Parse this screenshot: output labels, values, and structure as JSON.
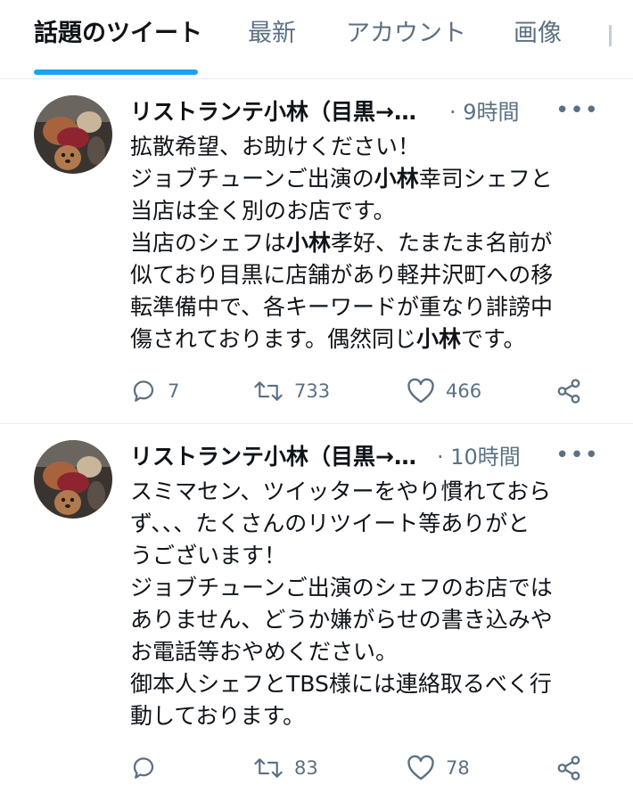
{
  "tabs": [
    {
      "label": "話題のツイート",
      "active": true
    },
    {
      "label": "最新",
      "active": false
    },
    {
      "label": "アカウント",
      "active": false
    },
    {
      "label": "画像",
      "active": false
    }
  ],
  "tweets": [
    {
      "display_name": "リストランテ小林（目黒→…",
      "time": "· 9時間",
      "more_label": "•••",
      "lines": [
        [
          {
            "t": "拡散希望、お助けください！",
            "b": false
          }
        ],
        [
          {
            "t": "ジョブチューンご出演の",
            "b": false
          },
          {
            "t": "小林",
            "b": true
          },
          {
            "t": "幸司シェフと",
            "b": false
          }
        ],
        [
          {
            "t": "当店は全く別のお店です。",
            "b": false
          }
        ],
        [
          {
            "t": "当店のシェフは",
            "b": false
          },
          {
            "t": "小林",
            "b": true
          },
          {
            "t": "孝好、たまたま名前が",
            "b": false
          }
        ],
        [
          {
            "t": "似ており目黒に店舗があり軽井沢町への移",
            "b": false
          }
        ],
        [
          {
            "t": "転準備中で、各キーワードが重なり誹謗中",
            "b": false
          }
        ],
        [
          {
            "t": "傷されております。偶然同じ",
            "b": false
          },
          {
            "t": "小林",
            "b": true
          },
          {
            "t": "です。",
            "b": false
          }
        ]
      ],
      "reply_count": "7",
      "retweet_count": "733",
      "like_count": "466"
    },
    {
      "display_name": "リストランテ小林（目黒→…",
      "time": "· 10時間",
      "more_label": "•••",
      "lines": [
        [
          {
            "t": "スミマセン、ツイッターをやり慣れておら",
            "b": false
          }
        ],
        [
          {
            "t": "ず、、、たくさんのリツイート等ありがと",
            "b": false
          }
        ],
        [
          {
            "t": "うございます！",
            "b": false
          }
        ],
        [
          {
            "t": "ジョブチューンご出演のシェフのお店では",
            "b": false
          }
        ],
        [
          {
            "t": "ありません、どうか嫌がらせの書き込みや",
            "b": false
          }
        ],
        [
          {
            "t": "お電話等おやめください。",
            "b": false
          }
        ],
        [
          {
            "t": "御本人シェフとTBS様には連絡取るべく行",
            "b": false
          }
        ],
        [
          {
            "t": "動しております。",
            "b": false
          }
        ]
      ],
      "reply_count": "",
      "retweet_count": "83",
      "like_count": "78"
    }
  ],
  "colors": {
    "accent": "#1da1f2",
    "text_primary": "#0f1419",
    "text_secondary": "#5b7083",
    "divider": "#e6ecf0"
  },
  "icons": [
    "reply-icon",
    "retweet-icon",
    "like-icon",
    "share-icon",
    "more-icon",
    "avatar-photo"
  ]
}
